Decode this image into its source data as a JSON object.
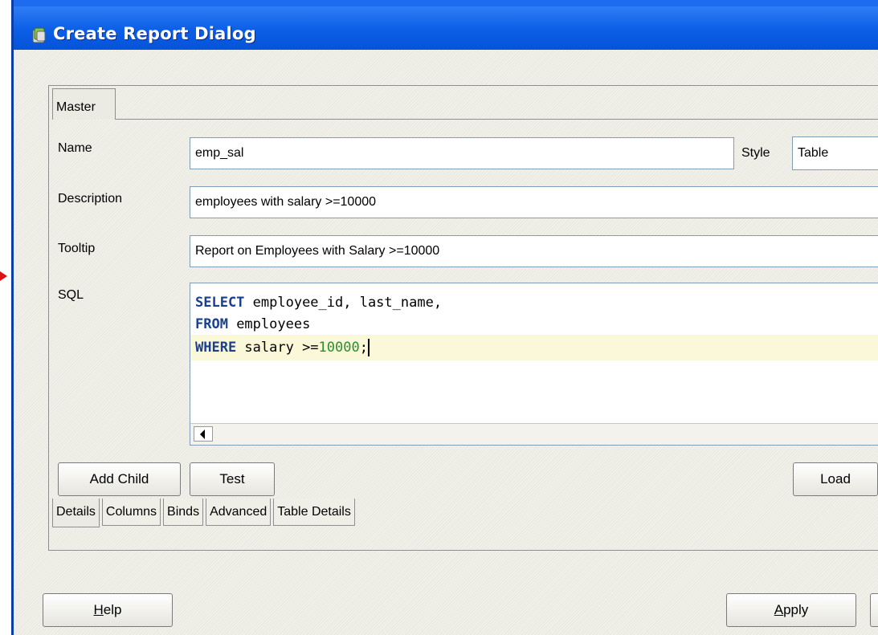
{
  "window": {
    "title": "Create Report Dialog"
  },
  "tabs": {
    "master": "Master"
  },
  "form": {
    "name_label": "Name",
    "name_value": "emp_sal",
    "style_label": "Style",
    "style_value": "Table",
    "description_label": "Description",
    "description_value": "employees with salary >=10000",
    "tooltip_label": "Tooltip",
    "tooltip_value": "Report on Employees with Salary >=10000",
    "sql_label": "SQL"
  },
  "sql": {
    "line1_kw": "SELECT",
    "line1_rest": " employee_id, last_name,",
    "line2_kw": "FROM",
    "line2_rest": " employees",
    "line3_kw": "WHERE",
    "line3_rest": " salary >=",
    "line3_num": "10000",
    "line3_end": ";"
  },
  "buttons": {
    "add_child": "Add Child",
    "test": "Test",
    "load": "Load",
    "help_prefix": "H",
    "help_rest": "elp",
    "apply_prefix": "A",
    "apply_rest": "pply"
  },
  "bottom_tabs": [
    "Details",
    "Columns",
    "Binds",
    "Advanced",
    "Table Details"
  ],
  "colors": {
    "titlebar": "#0a5ee6",
    "sql_keyword": "#1a3f8f",
    "sql_number": "#2c8f2c",
    "current_line": "#fbf7d9"
  }
}
